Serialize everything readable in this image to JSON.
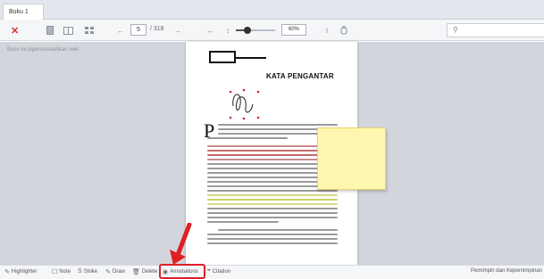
{
  "tabs": [
    {
      "label": "Buku 1"
    }
  ],
  "toolbar": {
    "page_current": "5",
    "page_total": "/ 318",
    "zoom": "60%",
    "zoom_level": 0.3
  },
  "sidebar": {
    "text": "Buku ini dipersembahkan oleh"
  },
  "document": {
    "heading": "KATA PENGANTAR",
    "dropcap": "P"
  },
  "bottom_bar": {
    "items": [
      {
        "label": "Highlighter",
        "icon": "pen-icon"
      },
      {
        "label": "Note",
        "icon": "note-icon"
      },
      {
        "label": "Strike",
        "icon": "strike-icon"
      },
      {
        "label": "Draw",
        "icon": "draw-icon"
      },
      {
        "label": "Delete",
        "icon": "trash-icon"
      },
      {
        "label": "Annotations",
        "icon": "eye-icon"
      },
      {
        "label": "Citation",
        "icon": "quote-icon"
      }
    ],
    "right_label": "Pemimpin dan Kepemimpinan"
  },
  "colors": {
    "accent": "#e01f26",
    "highlight_yellow": "#fff7b0"
  }
}
